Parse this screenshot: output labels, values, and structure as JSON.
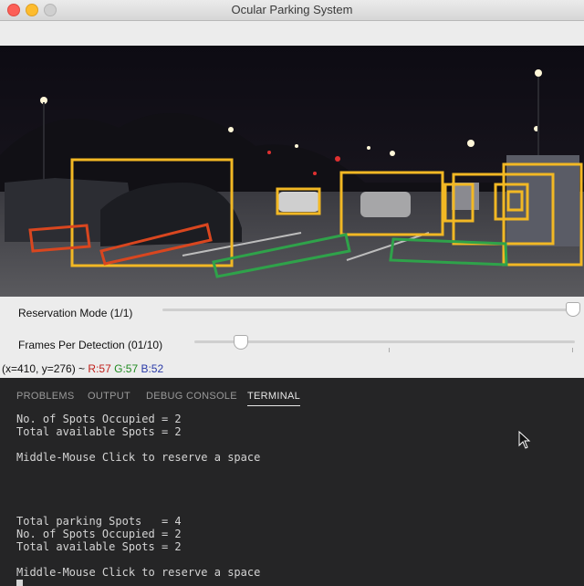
{
  "window": {
    "title": "Ocular Parking System"
  },
  "controls": {
    "reservation_label": "Reservation Mode (1/1)",
    "fpd_label": "Frames Per Detection (01/10)",
    "coords_prefix": "(x=410, y=276) ~ ",
    "r": "R:57",
    "g": "G:57",
    "b": "B:52"
  },
  "panel": {
    "tabs": [
      {
        "label": "PROBLEMS"
      },
      {
        "label": "OUTPUT"
      },
      {
        "label": "DEBUG CONSOLE"
      },
      {
        "label": "TERMINAL"
      }
    ],
    "active_tab": "TERMINAL",
    "terminal_text": "No. of Spots Occupied = 2\nTotal available Spots = 2\n\nMiddle-Mouse Click to reserve a space\n\n\n\n\nTotal parking Spots   = 4\nNo. of Spots Occupied = 2\nTotal available Spots = 2\n\nMiddle-Mouse Click to reserve a space"
  },
  "colors": {
    "box_yellow": "#f2b824",
    "spot_occupied": "#d9461f",
    "spot_free": "#2fa24a"
  },
  "sliders": {
    "reservation_mode": 1.0,
    "frames_per_detection": 0.1
  }
}
